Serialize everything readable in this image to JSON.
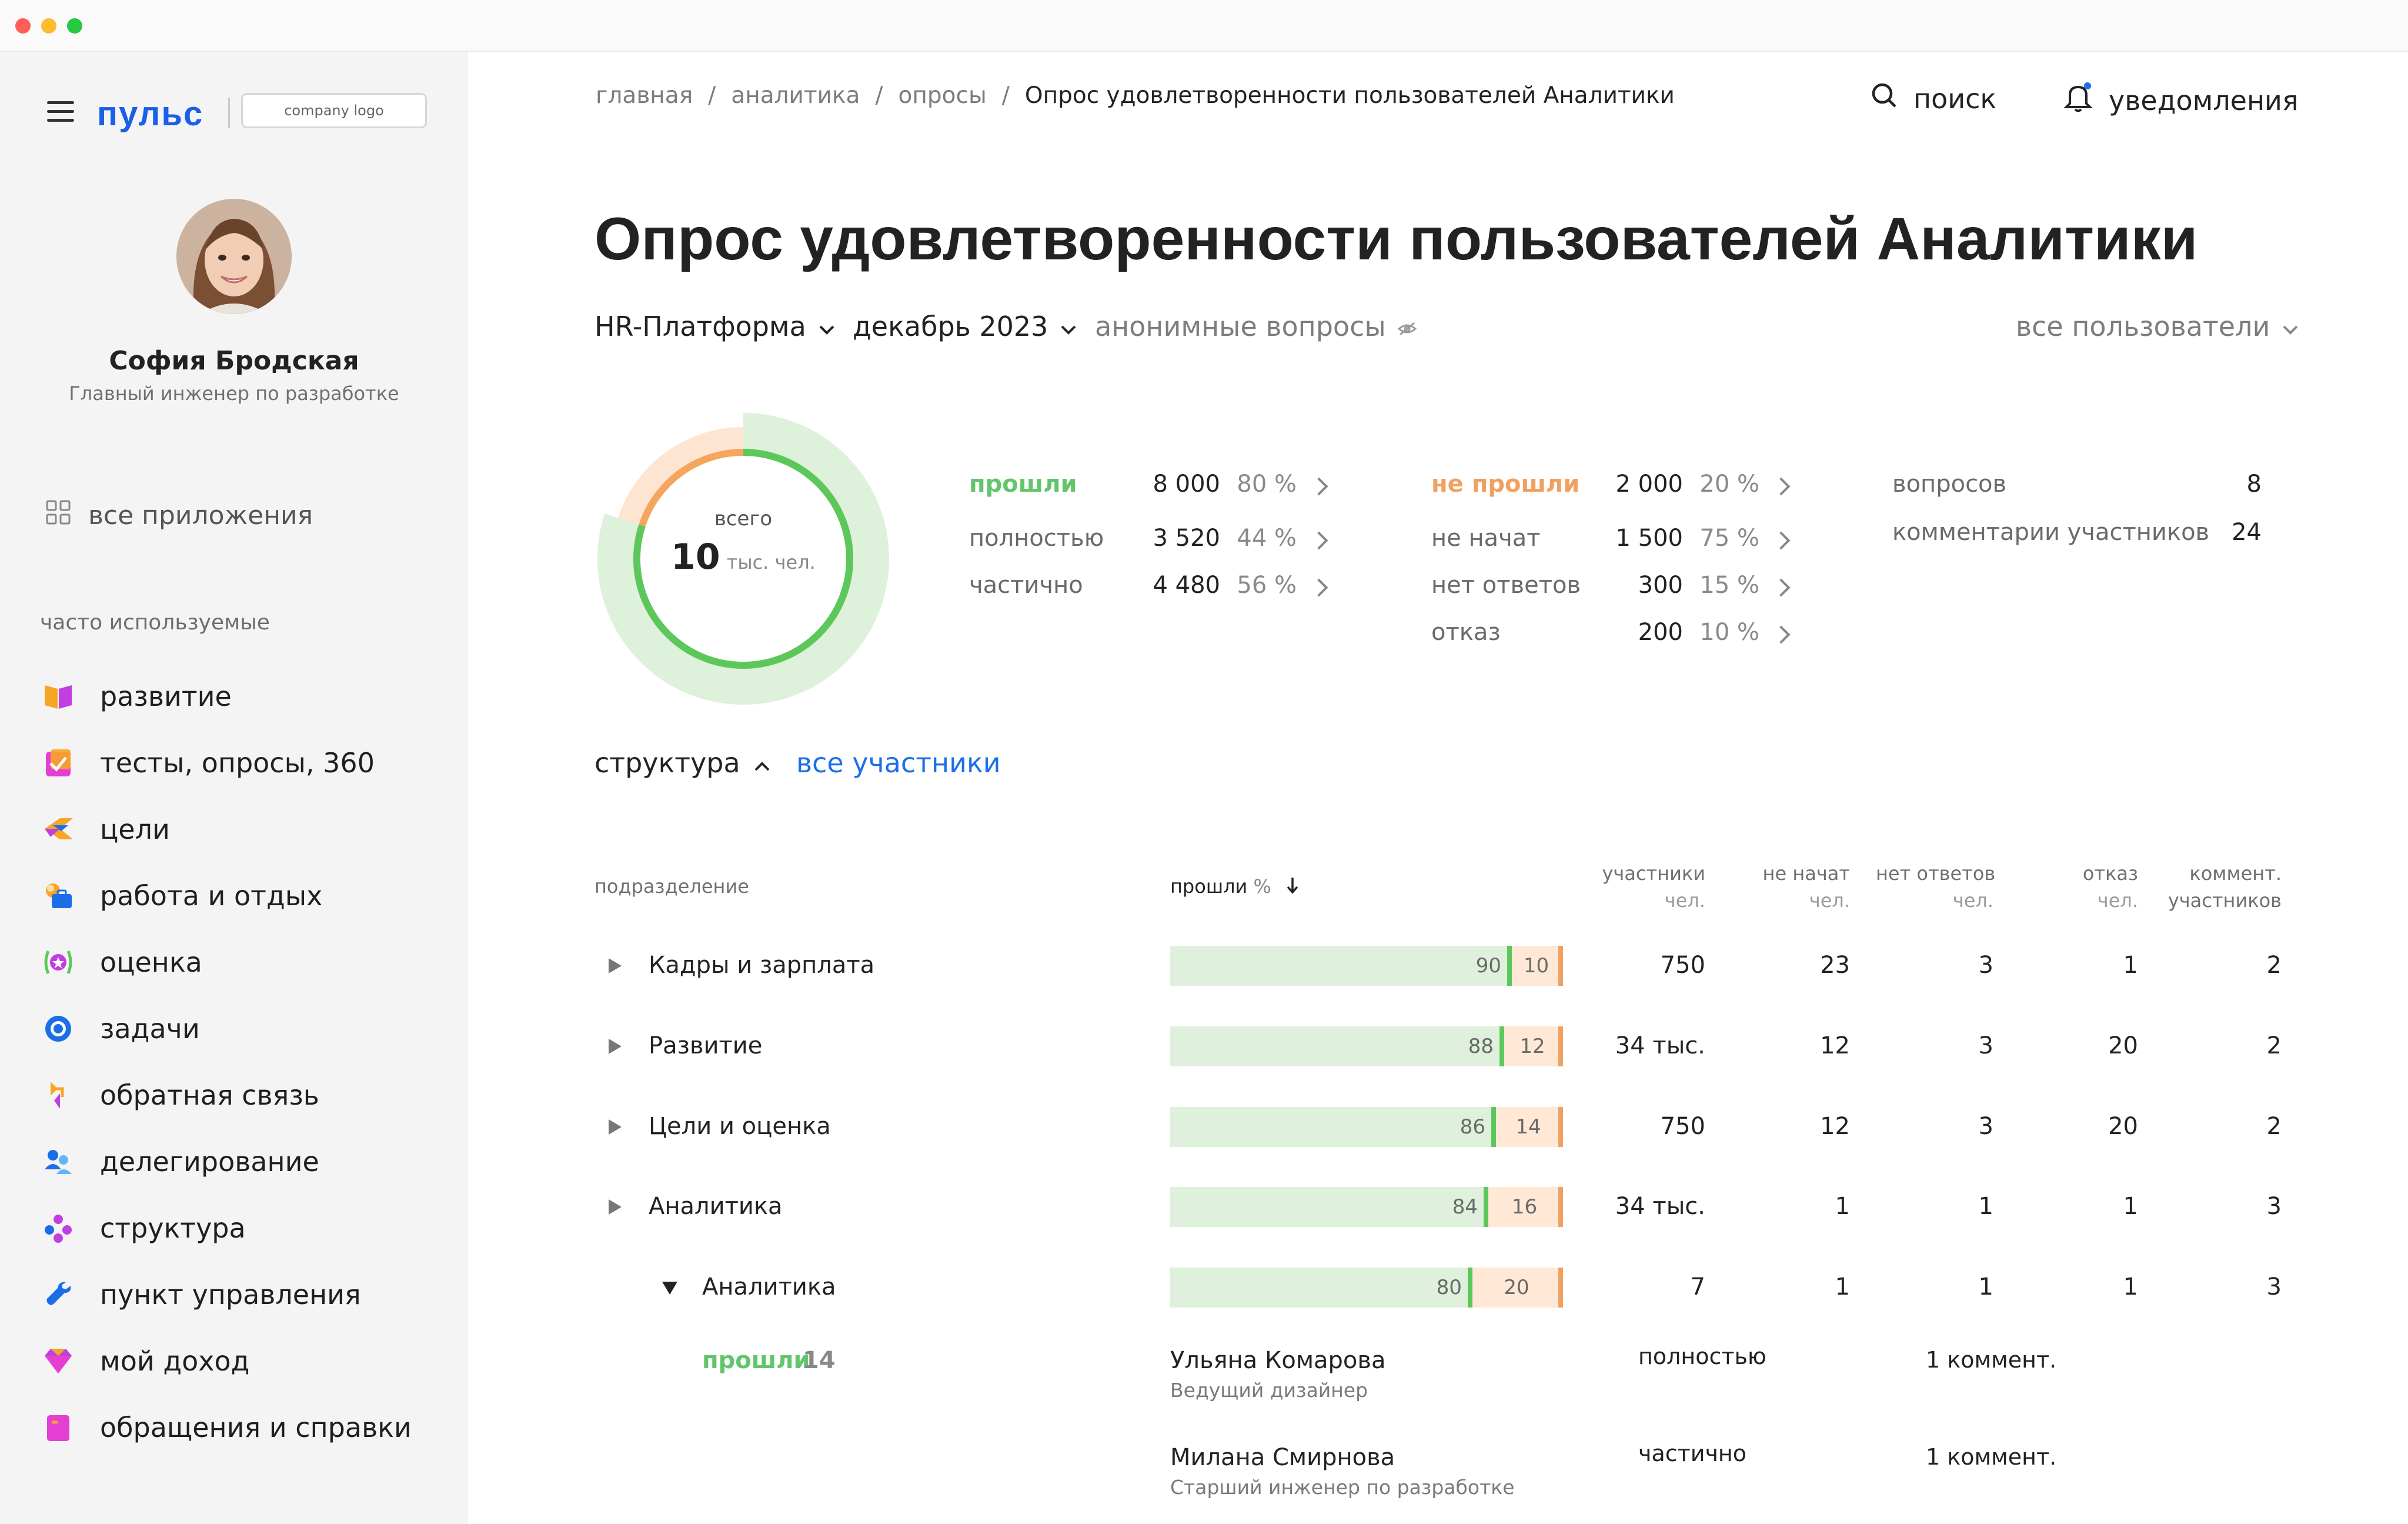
{
  "window": {
    "dots": [
      "#ff5f57",
      "#febc2e",
      "#28c840"
    ]
  },
  "sidebar": {
    "brand": "пульс",
    "company_logo": "company logo",
    "user": {
      "name": "София Бродская",
      "role": "Главный инженер по разработке"
    },
    "all_apps": "все приложения",
    "section_label": "часто используемые",
    "items": [
      {
        "label": "развитие",
        "icon": "book-icon"
      },
      {
        "label": "тесты, опросы, 360",
        "icon": "checkbox-icon"
      },
      {
        "label": "цели",
        "icon": "flag-icon"
      },
      {
        "label": "работа и отдых",
        "icon": "briefcase-icon"
      },
      {
        "label": "оценка",
        "icon": "star-badge-icon"
      },
      {
        "label": "задачи",
        "icon": "target-icon"
      },
      {
        "label": "обратная связь",
        "icon": "feedback-icon"
      },
      {
        "label": "делегирование",
        "icon": "people-icon"
      },
      {
        "label": "структура",
        "icon": "structure-icon"
      },
      {
        "label": "пункт управления",
        "icon": "wrench-icon"
      },
      {
        "label": "мой доход",
        "icon": "diamond-icon"
      },
      {
        "label": "обращения и справки",
        "icon": "request-icon"
      }
    ]
  },
  "header": {
    "breadcrumb": [
      "главная",
      "аналитика",
      "опросы",
      "Опрос удовлетворенности пользователей Аналитики"
    ],
    "search_label": "поиск",
    "notifications_label": "уведомления"
  },
  "page": {
    "title": "Опрос удовлетворенности пользователей Аналитики",
    "filters": {
      "platform": "HR-Платформа",
      "period": "декабрь 2023",
      "anonymous": "анонимные вопросы",
      "users": "все пользователи"
    }
  },
  "summary": {
    "total_label": "всего",
    "total_value": "10",
    "total_unit": "тыс. чел.",
    "passed_fraction": 0.8,
    "passed": [
      {
        "label": "прошли",
        "value": "8 000",
        "pct": "80 %"
      },
      {
        "label": "полностью",
        "value": "3 520",
        "pct": "44 %"
      },
      {
        "label": "частично",
        "value": "4 480",
        "pct": "56 %"
      }
    ],
    "not_passed": [
      {
        "label": "не прошли",
        "value": "2 000",
        "pct": "20 %"
      },
      {
        "label": "не начат",
        "value": "1 500",
        "pct": "75 %"
      },
      {
        "label": "нет ответов",
        "value": "300",
        "pct": "15 %"
      },
      {
        "label": "отказ",
        "value": "200",
        "pct": "10 %"
      }
    ],
    "extra": [
      {
        "label": "вопросов",
        "value": "8"
      },
      {
        "label": "комментарии участников",
        "value": "24"
      }
    ],
    "colors": {
      "passed": "#62c56b",
      "not_passed": "#f0a160"
    }
  },
  "structure": {
    "toggle_label": "структура",
    "all_participants": "все участники"
  },
  "table": {
    "headers": {
      "division": "подразделение",
      "passed": "прошли",
      "passed_unit": "%",
      "participants": [
        "участники",
        "чел."
      ],
      "not_started": [
        "не начат",
        "чел."
      ],
      "no_answers": [
        "нет ответов",
        "чел."
      ],
      "refused": [
        "отказ",
        "чел."
      ],
      "comments": [
        "коммент.",
        "участников"
      ]
    },
    "rows": [
      {
        "name": "Кадры и зарплата",
        "passed": "90",
        "failed": "10",
        "participants": "750",
        "not_started": "23",
        "no_answers": "3",
        "refused": "1",
        "comments": "2"
      },
      {
        "name": "Развитие",
        "passed": "88",
        "failed": "12",
        "participants": "34 тыс.",
        "not_started": "12",
        "no_answers": "3",
        "refused": "20",
        "comments": "2"
      },
      {
        "name": "Цели и оценка",
        "passed": "86",
        "failed": "14",
        "participants": "750",
        "not_started": "12",
        "no_answers": "3",
        "refused": "20",
        "comments": "2"
      },
      {
        "name": "Аналитика",
        "passed": "84",
        "failed": "16",
        "participants": "34 тыс.",
        "not_started": "1",
        "no_answers": "1",
        "refused": "1",
        "comments": "3"
      },
      {
        "name": "Аналитика",
        "passed": "80",
        "failed": "20",
        "participants": "7",
        "not_started": "1",
        "no_answers": "1",
        "refused": "1",
        "comments": "3"
      }
    ],
    "passed_group": {
      "label": "прошли",
      "count": "14"
    },
    "people": [
      {
        "name": "Ульяна Комарова",
        "role": "Ведущий дизайнер",
        "status": "полностью",
        "comment": "1 коммент."
      },
      {
        "name": "Милана Смирнова",
        "role": "Старший инженер по разработке",
        "status": "частично",
        "comment": "1 коммент."
      }
    ]
  }
}
